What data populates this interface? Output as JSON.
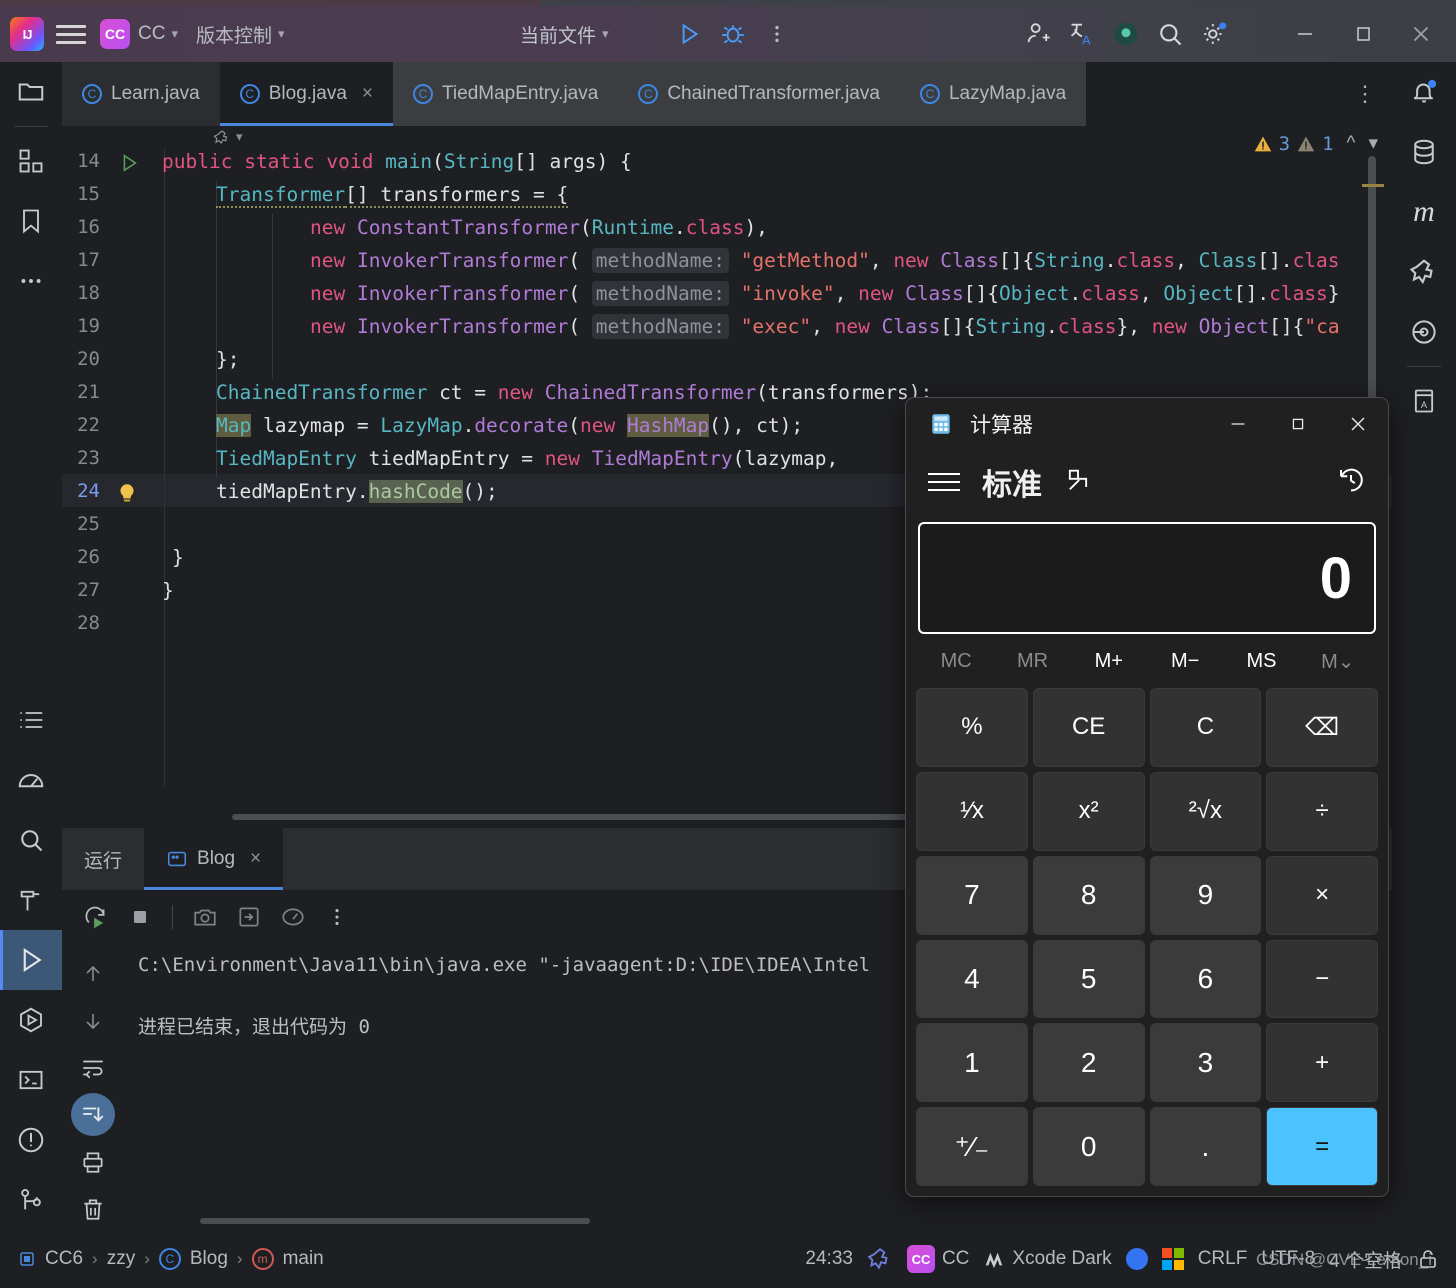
{
  "ide": {
    "toolbar": {
      "logo_icon": "intellij-idea-logo",
      "menu_icon": "hamburger-menu-icon",
      "project_badge": "CC",
      "project_name": "CC",
      "vcs_label": "版本控制",
      "current_file_label": "当前文件",
      "run_icon": "run-icon",
      "debug_icon": "debug-icon",
      "more_icon": "more-vertical-icon",
      "share_icon": "add-user-icon",
      "translate_icon": "translate-icon",
      "record_icon": "record-indicator-icon",
      "search_icon": "search-icon",
      "settings_icon": "gear-icon",
      "minimize_icon": "minimize-icon",
      "maximize_icon": "maximize-icon",
      "close_icon": "close-icon"
    },
    "tabs": [
      {
        "label": "Learn.java",
        "active": false,
        "closable": false
      },
      {
        "label": "Blog.java",
        "active": true,
        "closable": true
      },
      {
        "label": "TiedMapEntry.java",
        "active": false,
        "closable": false
      },
      {
        "label": "ChainedTransformer.java",
        "active": false,
        "closable": false
      },
      {
        "label": "LazyMap.java",
        "active": false,
        "closable": false
      }
    ],
    "left_strip": [
      {
        "name": "project-icon"
      },
      {
        "name": "structure-icon"
      },
      {
        "name": "bookmarks-icon"
      },
      {
        "name": "more-tool-windows-icon"
      },
      {
        "name": "todo-icon"
      },
      {
        "name": "profiler-icon"
      },
      {
        "name": "find-icon"
      },
      {
        "name": "build-icon"
      },
      {
        "name": "run-tool-icon"
      },
      {
        "name": "debug-tool-icon"
      },
      {
        "name": "terminal-icon"
      },
      {
        "name": "problems-icon"
      },
      {
        "name": "git-icon"
      }
    ],
    "right_strip": [
      {
        "name": "notifications-icon"
      },
      {
        "name": "database-icon"
      },
      {
        "name": "maven-icon"
      },
      {
        "name": "gradle-icon"
      },
      {
        "name": "endpoints-icon"
      },
      {
        "name": "translation-dictionary-icon"
      }
    ],
    "editor": {
      "warnings": {
        "warn_icon": "warning-triangle-icon",
        "warn_count": "3",
        "weak_icon": "weak-warning-icon",
        "weak_count": "1",
        "up_icon": "chevron-up-icon",
        "down_icon": "chevron-down-icon"
      },
      "lines": [
        {
          "num": "14",
          "gutter": "run-gutter-icon"
        },
        {
          "num": "15",
          "gutter": ""
        },
        {
          "num": "16",
          "gutter": ""
        },
        {
          "num": "17",
          "gutter": ""
        },
        {
          "num": "18",
          "gutter": ""
        },
        {
          "num": "19",
          "gutter": ""
        },
        {
          "num": "20",
          "gutter": ""
        },
        {
          "num": "21",
          "gutter": ""
        },
        {
          "num": "22",
          "gutter": ""
        },
        {
          "num": "23",
          "gutter": ""
        },
        {
          "num": "24",
          "gutter": "intention-bulb-icon"
        },
        {
          "num": "25",
          "gutter": ""
        },
        {
          "num": "26",
          "gutter": ""
        },
        {
          "num": "27",
          "gutter": ""
        },
        {
          "num": "28",
          "gutter": ""
        }
      ],
      "code": {
        "l14": "public static void main(String[] args) {",
        "l15": "Transformer[] transformers = {",
        "l16": "new ConstantTransformer(Runtime.class),",
        "l17_hint": "methodName:",
        "l17": "\"getMethod\", new Class[]{String.class, Class[].class",
        "l18_hint": "methodName:",
        "l18": "\"invoke\", new Class[]{Object.class, Object[].class}",
        "l19_hint": "methodName:",
        "l19": "\"exec\", new Class[]{String.class}, new Object[]{\"ca",
        "l20": "};",
        "l21": "ChainedTransformer ct = new ChainedTransformer(transformers);",
        "l22": "Map lazymap = LazyMap.decorate(new HashMap(), ct);",
        "l23": "TiedMapEntry tiedMapEntry = new TiedMapEntry(lazymap,",
        "l24": "tiedMapEntry.hashCode();",
        "l26": "}",
        "l27": "}"
      }
    },
    "run_panel": {
      "tool_tab": "运行",
      "config_tab": "Blog",
      "config_icon": "run-config-icon",
      "close_icon": "close-icon",
      "toolbar_icons": [
        "rerun-icon",
        "stop-icon",
        "camera-icon",
        "dump-threads-icon",
        "profiler-icon",
        "more-vertical-icon"
      ],
      "gutter_icons": [
        "scroll-up-icon",
        "scroll-down-icon",
        "soft-wrap-icon",
        "scroll-to-end-icon",
        "print-icon",
        "clear-all-icon"
      ],
      "console_line1": "C:\\Environment\\Java11\\bin\\java.exe \"-javaagent:D:\\IDE\\IDEA\\Intel",
      "console_line2": "进程已结束，退出代码为 0"
    },
    "status_bar": {
      "breadcrumb": [
        {
          "label": "CC6",
          "icon": "module-icon"
        },
        {
          "label": "zzy",
          "icon": ""
        },
        {
          "label": "Blog",
          "icon": "class-icon"
        },
        {
          "label": "main",
          "icon": "method-icon"
        }
      ],
      "separator": "›",
      "caret": "24:33",
      "gradle_icon": "gradle-icon",
      "branch_badge": "CC",
      "branch_name": "CC",
      "theme_icon": "theme-icon",
      "theme_name": "Xcode Dark",
      "sync_icon": "blue-dot-icon",
      "windows_icon": "windows-logo-icon",
      "line_sep": "CRLF",
      "encoding": "UTF-8",
      "indent": "4 个空格",
      "lock_icon": "unlocked-icon",
      "watermark": "CSDN @CVE-Lemon_i"
    }
  },
  "calculator": {
    "app_icon": "calculator-icon",
    "title": "计算器",
    "minimize_icon": "minimize-icon",
    "maximize_icon": "maximize-icon",
    "close_icon": "close-icon",
    "menu_icon": "hamburger-menu-icon",
    "mode": "标准",
    "keep_on_top_icon": "keep-on-top-icon",
    "history_icon": "history-icon",
    "display_value": "0",
    "memory": [
      {
        "label": "MC",
        "dim": true
      },
      {
        "label": "MR",
        "dim": true
      },
      {
        "label": "M+",
        "dim": false
      },
      {
        "label": "M−",
        "dim": false
      },
      {
        "label": "MS",
        "dim": false
      },
      {
        "label": "M⌄",
        "dim": true
      }
    ],
    "keys": [
      {
        "label": "%",
        "type": "fn"
      },
      {
        "label": "CE",
        "type": "fn"
      },
      {
        "label": "C",
        "type": "fn"
      },
      {
        "label": "⌫",
        "type": "fn"
      },
      {
        "label": "¹⁄x",
        "type": "fn"
      },
      {
        "label": "x²",
        "type": "fn"
      },
      {
        "label": "²√x",
        "type": "fn"
      },
      {
        "label": "÷",
        "type": "fn"
      },
      {
        "label": "7",
        "type": "num"
      },
      {
        "label": "8",
        "type": "num"
      },
      {
        "label": "9",
        "type": "num"
      },
      {
        "label": "×",
        "type": "fn"
      },
      {
        "label": "4",
        "type": "num"
      },
      {
        "label": "5",
        "type": "num"
      },
      {
        "label": "6",
        "type": "num"
      },
      {
        "label": "−",
        "type": "fn"
      },
      {
        "label": "1",
        "type": "num"
      },
      {
        "label": "2",
        "type": "num"
      },
      {
        "label": "3",
        "type": "num"
      },
      {
        "label": "+",
        "type": "fn"
      },
      {
        "label": "⁺⁄₋",
        "type": "num"
      },
      {
        "label": "0",
        "type": "num"
      },
      {
        "label": ".",
        "type": "num"
      },
      {
        "label": "=",
        "type": "eq"
      }
    ]
  }
}
